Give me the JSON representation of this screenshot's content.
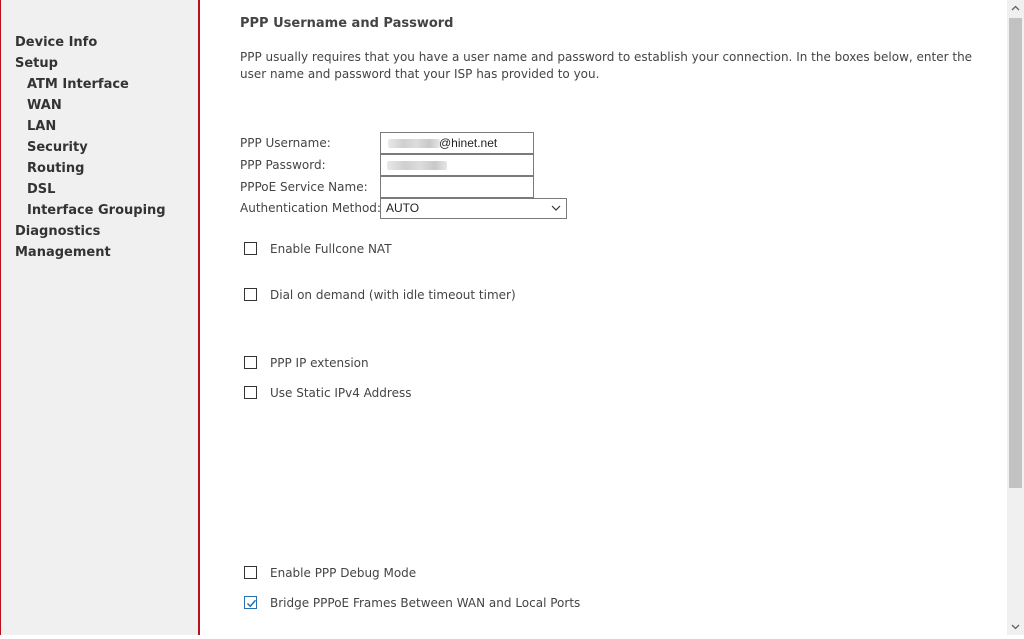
{
  "sidebar": {
    "items": [
      {
        "label": "Device Info"
      },
      {
        "label": "Setup"
      },
      {
        "label": "ATM Interface"
      },
      {
        "label": "WAN"
      },
      {
        "label": "LAN"
      },
      {
        "label": "Security"
      },
      {
        "label": "Routing"
      },
      {
        "label": "DSL"
      },
      {
        "label": "Interface Grouping"
      },
      {
        "label": "Diagnostics"
      },
      {
        "label": "Management"
      }
    ]
  },
  "main": {
    "title": "PPP Username and Password",
    "intro": "PPP usually requires that you have a user name and password to establish your connection. In the boxes below, enter the user name and password that your ISP has provided to you.",
    "form": {
      "username_label": "PPP Username:",
      "username_value": "@hinet.net",
      "password_label": "PPP Password:",
      "service_label": "PPPoE Service Name:",
      "service_value": "",
      "auth_label": "Authentication Method:",
      "auth_value": "AUTO"
    },
    "checkboxes": [
      {
        "label": "Enable Fullcone NAT",
        "checked": false
      },
      {
        "label": "Dial on demand (with idle timeout timer)",
        "checked": false
      },
      {
        "label": "PPP IP extension",
        "checked": false
      },
      {
        "label": "Use Static IPv4 Address",
        "checked": false
      },
      {
        "label": "Enable PPP Debug Mode",
        "checked": false
      },
      {
        "label": "Bridge PPPoE Frames Between WAN and Local Ports",
        "checked": true
      }
    ]
  },
  "colors": {
    "accent_border": "#b5121b",
    "sidebar_bg": "#f0f0f0",
    "checkmark": "#2a6fb0"
  },
  "icons": [
    "chevron-down-icon",
    "checkmark-icon",
    "scroll-up-arrow-icon",
    "scroll-down-arrow-icon"
  ]
}
